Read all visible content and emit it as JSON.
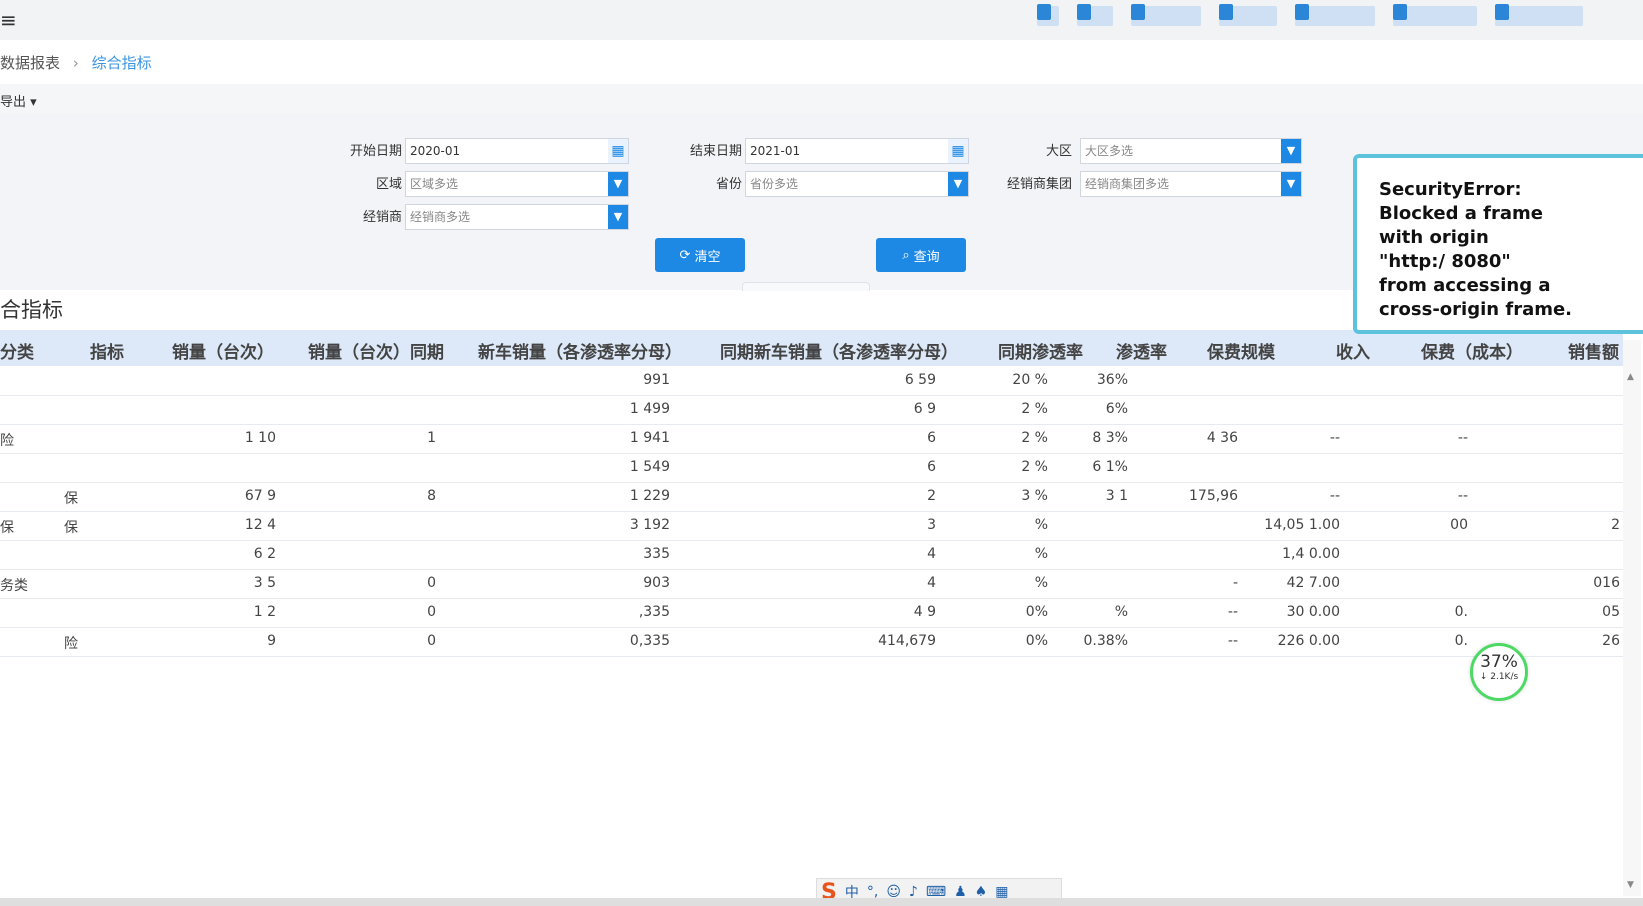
{
  "topbar": {
    "menu_icon": "hamburger-icon"
  },
  "breadcrumb": {
    "parent": "数据报表",
    "current": "综合指标"
  },
  "toolbar": {
    "export_label": "导出 ▾"
  },
  "filters": {
    "start_date": {
      "label": "开始日期",
      "value": "2020-01"
    },
    "end_date": {
      "label": "结束日期",
      "value": "2021-01"
    },
    "region_big": {
      "label": "大区",
      "placeholder": "大区多选"
    },
    "region": {
      "label": "区域",
      "placeholder": "区域多选"
    },
    "province": {
      "label": "省份",
      "placeholder": "省份多选"
    },
    "dealer_group": {
      "label": "经销商集团",
      "placeholder": "经销商集团多选"
    },
    "dealer": {
      "label": "经销商",
      "placeholder": "经销商多选"
    }
  },
  "buttons": {
    "clear": "清空",
    "query": "查询"
  },
  "section_title": "合指标",
  "table": {
    "headers": [
      "分类",
      "指标",
      "销量（台次）",
      "销量（台次）同期",
      "新车销量（各渗透率分母）",
      "同期新车销量（各渗透率分母）",
      "同期渗透率",
      "渗透率",
      "保费规模",
      "收入",
      "保费（成本）",
      "销售额"
    ],
    "rows": [
      {
        "category": "",
        "metric": "",
        "sales": "",
        "sales_ly": "",
        "new_car": "991",
        "new_car_ly": "6 59",
        "pen_ly": "20 %",
        "pen": "36%",
        "premium": "",
        "income": "",
        "cost": "",
        "revenue": ""
      },
      {
        "category": "",
        "metric": "",
        "sales": "",
        "sales_ly": "",
        "new_car": "1 499",
        "new_car_ly": "6 9",
        "pen_ly": "2 %",
        "pen": "6%",
        "premium": "",
        "income": "",
        "cost": "",
        "revenue": ""
      },
      {
        "category": "险",
        "metric": "",
        "sales": "1 10",
        "sales_ly": "1",
        "new_car": "1 941",
        "new_car_ly": "6",
        "pen_ly": "2 %",
        "pen": "8 3%",
        "premium": "4 36",
        "income": "--",
        "cost": "--",
        "revenue": ""
      },
      {
        "category": "",
        "metric": "",
        "sales": "",
        "sales_ly": "",
        "new_car": "1 549",
        "new_car_ly": "6",
        "pen_ly": "2 %",
        "pen": "6 1%",
        "premium": "",
        "income": "",
        "cost": "",
        "revenue": ""
      },
      {
        "category": "",
        "metric": "保",
        "sales": "67 9",
        "sales_ly": "8",
        "new_car": "1 229",
        "new_car_ly": "2",
        "pen_ly": "3 %",
        "pen": "3 1",
        "premium": "175,96",
        "income": "--",
        "cost": "--",
        "revenue": ""
      },
      {
        "category": "保",
        "metric": "保",
        "sales": "12 4",
        "sales_ly": "",
        "new_car": "3 192",
        "new_car_ly": "3",
        "pen_ly": "%",
        "pen": "",
        "premium": "",
        "income": "14,05 1.00",
        "cost": "00",
        "revenue": "2"
      },
      {
        "category": "",
        "metric": "",
        "sales": "6 2",
        "sales_ly": "",
        "new_car": "335",
        "new_car_ly": "4",
        "pen_ly": "%",
        "pen": "",
        "premium": "",
        "income": "1,4 0.00",
        "cost": "",
        "revenue": ""
      },
      {
        "category": "务类",
        "metric": "",
        "sales": "3 5",
        "sales_ly": "0",
        "new_car": "903",
        "new_car_ly": "4",
        "pen_ly": "%",
        "pen": "",
        "premium": "-",
        "income": "42 7.00",
        "cost": "",
        "revenue": "016"
      },
      {
        "category": "",
        "metric": "",
        "sales": "1 2",
        "sales_ly": "0",
        "new_car": ",335",
        "new_car_ly": "4 9",
        "pen_ly": "0%",
        "pen": "%",
        "premium": "--",
        "income": "30 0.00",
        "cost": "0.",
        "revenue": "05"
      },
      {
        "category": "",
        "metric": "险",
        "sales": "9",
        "sales_ly": "0",
        "new_car": "0,335",
        "new_car_ly": "414,679",
        "pen_ly": "0%",
        "pen": "0.38%",
        "premium": "--",
        "income": "226 0.00",
        "cost": "0.",
        "revenue": "26"
      }
    ]
  },
  "error_panel": {
    "line1": "SecurityError:",
    "line2": "Blocked a frame",
    "line3": "with origin",
    "line4": "\"http:/ 8080\"",
    "line5": "from accessing a",
    "line6": "cross-origin frame."
  },
  "net_widget": {
    "percent": "37%",
    "speed": "↓ 2.1K/s"
  },
  "ime": {
    "logo": "S",
    "mode": "中"
  }
}
